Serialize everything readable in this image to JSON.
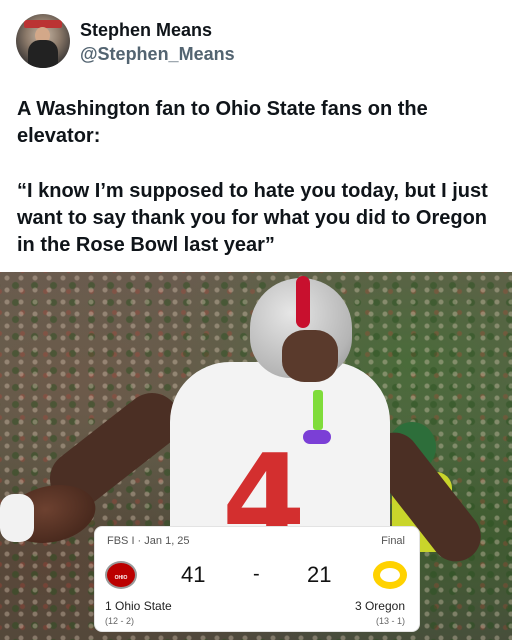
{
  "author": {
    "name": "Stephen Means",
    "handle": "@Stephen_Means"
  },
  "tweet": {
    "line1": "A Washington fan to Ohio State fans on the elevator:",
    "line2": "“I know I’m supposed to hate you today, but I just want to say thank you for what you did to Oregon in the Rose Bowl last year”"
  },
  "scoreboard": {
    "meta": "FBS I · Jan 1, 25",
    "status": "Final",
    "home": {
      "rank_name": "1 Ohio State",
      "record": "(12 - 2)",
      "score": "41",
      "logo_text": "OHIO STATE"
    },
    "away": {
      "rank_name": "3 Oregon",
      "record": "(13 - 1)",
      "score": "21"
    },
    "separator": "-"
  },
  "photo": {
    "jersey_number": "4"
  }
}
